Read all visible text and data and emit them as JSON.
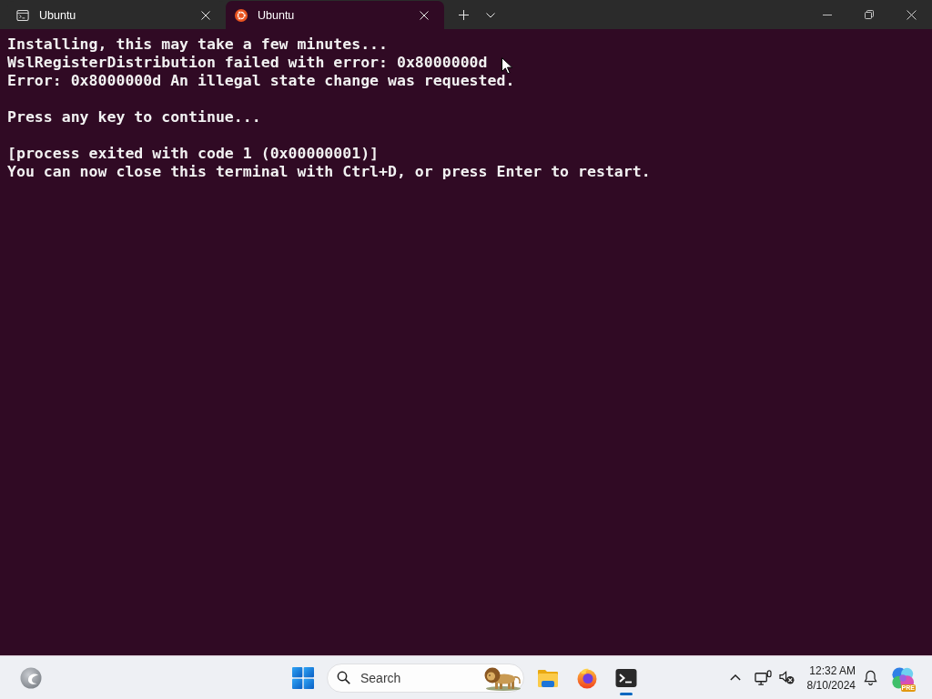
{
  "window": {
    "tabs": [
      {
        "title": "Ubuntu",
        "kind": "console",
        "selected": false
      },
      {
        "title": "Ubuntu",
        "kind": "ubuntu",
        "selected": true
      }
    ]
  },
  "terminal": {
    "paragraphs": [
      [
        "Installing, this may take a few minutes...",
        "WslRegisterDistribution failed with error: 0x8000000d",
        "Error: 0x8000000d An illegal state change was requested."
      ],
      [
        "Press any key to continue..."
      ],
      [
        "[process exited with code 1 (0x00000001)]",
        "You can now close this terminal with Ctrl+D, or press Enter to restart."
      ]
    ]
  },
  "taskbar": {
    "search": {
      "placeholder": "Search"
    },
    "apps": [
      {
        "kind": "files",
        "active": false
      },
      {
        "kind": "firefox",
        "active": false
      },
      {
        "kind": "terminal",
        "active": true
      }
    ],
    "clock": {
      "time": "12:32 AM",
      "date": "8/10/2024"
    },
    "copilot_badge": "PRE"
  }
}
